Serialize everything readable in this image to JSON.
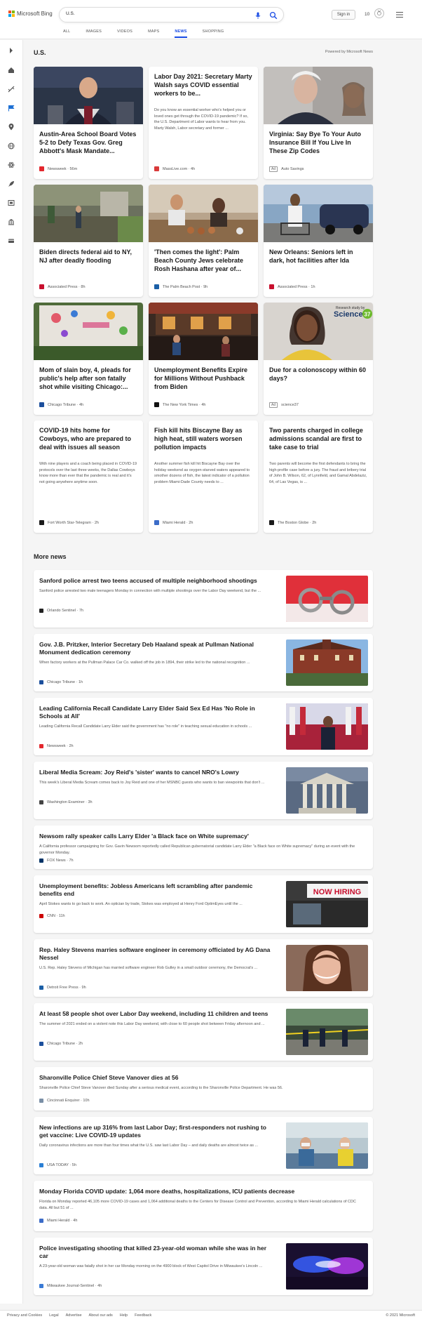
{
  "brand": {
    "name": "Microsoft Bing"
  },
  "search": {
    "query": "U.S."
  },
  "header": {
    "signin_label": "Sign in",
    "points": "10"
  },
  "tabs": [
    "ALL",
    "IMAGES",
    "VIDEOS",
    "MAPS",
    "NEWS",
    "SHOPPING"
  ],
  "active_tab": "NEWS",
  "section": {
    "title": "U.S.",
    "powered": "Powered by Microsoft News"
  },
  "cards": [
    {
      "title": "Austin-Area School Board Votes 5-2 to Defy Texas Gov. Greg Abbott's Mask Mandate...",
      "source": "Newsweek",
      "time": "56m",
      "fav_color": "#e3272d"
    },
    {
      "title": "Labor Day 2021: Secretary Marty Walsh says COVID essential workers to be...",
      "snippet": "Do you know an essential worker who's helped you or loved ones get through the COVID-19 pandemic? If so, the U.S. Department of Labor wants to hear from you. Marty Walsh, Labor secretary and former ...",
      "source": "MassLive.com",
      "time": "4h",
      "fav_color": "#d93a3a"
    },
    {
      "title": "Virginia: Say Bye To Your Auto Insurance Bill If You Live In These Zip Codes",
      "source": "Auto Savings",
      "ad": "Ad"
    },
    {
      "title": "Biden directs federal aid to NY, NJ after deadly flooding",
      "source": "Associated Press",
      "time": "8h",
      "fav_color": "#c8102e"
    },
    {
      "title": "'Then comes the light': Palm Beach County Jews celebrate Rosh Hashana after year of...",
      "source": "The Palm Beach Post",
      "time": "9h",
      "fav_color": "#1b5fa6"
    },
    {
      "title": "New Orleans: Seniors left in dark, hot facilities after Ida",
      "source": "Associated Press",
      "time": "1h",
      "fav_color": "#c8102e"
    },
    {
      "title": "Mom of slain boy, 4, pleads for public's help after son fatally shot while visiting Chicago:...",
      "source": "Chicago Tribune",
      "time": "4h",
      "fav_color": "#1c4f9c"
    },
    {
      "title": "Unemployment Benefits Expire for Millions Without Pushback from Biden",
      "source": "The New York Times",
      "time": "4h",
      "fav_color": "#111111"
    },
    {
      "title": "Due for a colonoscopy within 60 days?",
      "source": "science37",
      "ad": "Ad",
      "badge_top": "Research study by",
      "badge_main": "Science",
      "badge_num": "37"
    },
    {
      "title": "COVID-19 hits home for Cowboys, who are prepared to deal with issues all season",
      "snippet": "With nine players and a coach being placed in COVID-19 protocols over the last three weeks, the Dallas Cowboys know more than ever that the pandemic is real and it's not going anywhere anytime soon.",
      "source": "Fort Worth Star-Telegram",
      "time": "2h",
      "fav_color": "#1a1a1a"
    },
    {
      "title": "Fish kill hits Biscayne Bay as high heat, still waters worsen pollution impacts",
      "snippet": "Another summer fish kill hit Biscayne Bay over the holiday weekend as oxygen-starved waters appeared to smother dozens of fish, the latest indicator of a pollution problem Miami-Dade County needs to ...",
      "source": "Miami Herald",
      "time": "2h",
      "fav_color": "#3c6cc8"
    },
    {
      "title": "Two parents charged in college admissions scandal are first to take case to trial",
      "snippet": "Two parents will become the first defendants to bring the high-profile case before a jury. The fraud and bribery trial of John B. Wilson, 62, of Lynnfield, and Gamal Abdelaziz, 64, of Las Vegas, is ...",
      "source": "The Boston Globe",
      "time": "2h",
      "fav_color": "#1a1a1a"
    }
  ],
  "more": {
    "title": "More news",
    "items": [
      {
        "title": "Sanford police arrest two teens accused of multiple neighborhood shootings",
        "snippet": "Sanford police arrested two male teenagers Monday in connection with multiple shootings over the Labor Day weekend, but the ...",
        "source": "Orlando Sentinel",
        "time": "7h",
        "fav_color": "#222222"
      },
      {
        "title": "Gov. J.B. Pritzker, Interior Secretary Deb Haaland speak at Pullman National Monument dedication ceremony",
        "snippet": "When factory workers at the Pullman Palace Car Co. walked off the job in 1894, their strike led to the national recognition ...",
        "source": "Chicago Tribune",
        "time": "1h",
        "fav_color": "#1c4f9c"
      },
      {
        "title": "Leading California Recall Candidate Larry Elder Said Sex Ed Has 'No Role in Schools at All'",
        "snippet": "Leading California Recall Candidate Larry Elder said the government has \"no role\" in teaching sexual education in schools ...",
        "source": "Newsweek",
        "time": "2h",
        "fav_color": "#e3272d"
      },
      {
        "title": "Liberal Media Scream: Joy Reid's 'sister' wants to cancel NRO's Lowry",
        "snippet": "This week's Liberal Media Scream comes back to Joy Reid and one of her MSNBC guests who wants to ban viewpoints that don't ...",
        "source": "Washington Examiner",
        "time": "3h",
        "fav_color": "#444444"
      },
      {
        "title": "Newsom rally speaker calls Larry Elder 'a Black face on White supremacy'",
        "snippet": "A California professor campaigning for Gov. Gavin Newsom reportedly called Republican gubernatorial candidate Larry Elder \"a Black face on White supremacy\" during an event with the governor Monday.",
        "source": "FOX News",
        "time": "7h",
        "fav_color": "#003366"
      },
      {
        "title": "Unemployment benefits: Jobless Americans left scrambling after pandemic benefits end",
        "snippet": "April Stokes wants to go back to work. An optician by trade, Stokes was employed at Henry Ford OptimEyes until the ...",
        "source": "CNN",
        "time": "11h",
        "fav_color": "#cc0000",
        "sign": "NOW HIRING"
      },
      {
        "title": "Rep. Haley Stevens marries software engineer in ceremony officiated by AG Dana Nessel",
        "snippet": "U.S. Rep. Haley Stevens of Michigan has married software engineer Rob Gulley in a small outdoor ceremony, the Democrat's ...",
        "source": "Detroit Free Press",
        "time": "9h",
        "fav_color": "#1b5fa6"
      },
      {
        "title": "At least 58 people shot over Labor Day weekend, including 11 children and teens",
        "snippet": "The summer of 2021 ended on a violent note this Labor Day weekend, with close to 60 people shot between Friday afternoon and ...",
        "source": "Chicago Tribune",
        "time": "2h",
        "fav_color": "#1c4f9c"
      },
      {
        "title": "Sharonville Police Chief Steve Vanover dies at 56",
        "snippet": "Sharonville Police Chief Steve Vanover died Sunday after a serious medical event, according to the Sharonville Police Department. He was 56.",
        "source": "Cincinnati Enquirer",
        "time": "10h",
        "fav_color": "#7a8fa6"
      },
      {
        "title": "New infections are up 316% from last Labor Day; first-responders not rushing to get vaccine: Live COVID-19 updates",
        "snippet": "Daily coronavirus infections are more than four times what the U.S. saw last Labor Day – and daily deaths are almost twice as ...",
        "source": "USA TODAY",
        "time": "5h",
        "fav_color": "#2a7fd4"
      },
      {
        "title": "Monday Florida COVID update: 1,064 more deaths, hospitalizations, ICU patients decrease",
        "snippet": "Florida on Monday reported 46,105 more COVID-19 cases and 1,064 additional deaths to the Centers for Disease Control and Prevention, according to Miami Herald calculations of CDC data. All but 51 of ...",
        "source": "Miami Herald",
        "time": "4h",
        "fav_color": "#3c6cc8"
      },
      {
        "title": "Police investigating shooting that killed 23-year-old woman while she was in her car",
        "snippet": "A 23-year-old woman was fatally shot in her car Monday morning on the 4900 block of West Capitol Drive in Milwaukee's Lincoln ...",
        "source": "Milwaukee Journal-Sentinel",
        "time": "4h",
        "fav_color": "#3a7bd5"
      }
    ]
  },
  "footer": {
    "links": [
      "Privacy and Cookies",
      "Legal",
      "Advertise",
      "About our ads",
      "Help",
      "Feedback"
    ],
    "copyright": "© 2021 Microsoft"
  }
}
